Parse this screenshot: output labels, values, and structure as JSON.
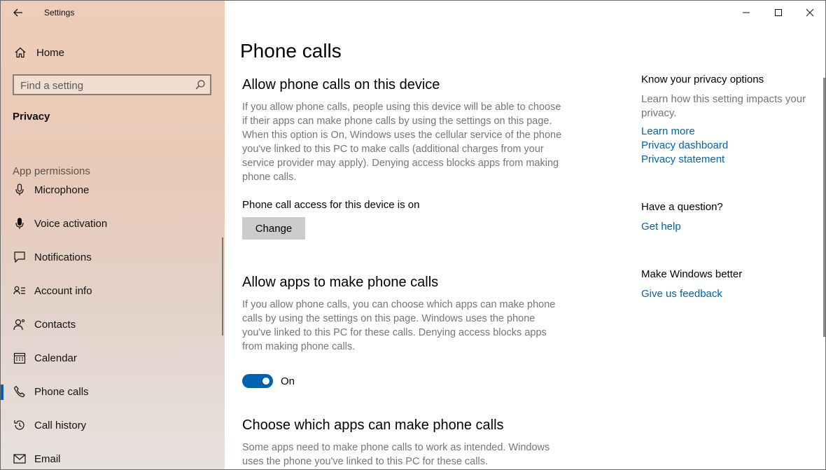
{
  "window": {
    "title": "Settings"
  },
  "sidebar": {
    "home_label": "Home",
    "search_placeholder": "Find a setting",
    "section_title": "Privacy",
    "perm_header": "App permissions",
    "items": [
      {
        "label": "Microphone",
        "icon": "microphone-icon"
      },
      {
        "label": "Voice activation",
        "icon": "voice-activation-icon"
      },
      {
        "label": "Notifications",
        "icon": "notifications-icon"
      },
      {
        "label": "Account info",
        "icon": "account-info-icon"
      },
      {
        "label": "Contacts",
        "icon": "contacts-icon"
      },
      {
        "label": "Calendar",
        "icon": "calendar-icon"
      },
      {
        "label": "Phone calls",
        "icon": "phone-icon",
        "active": true
      },
      {
        "label": "Call history",
        "icon": "call-history-icon"
      },
      {
        "label": "Email",
        "icon": "email-icon"
      }
    ]
  },
  "main": {
    "title": "Phone calls",
    "section1": {
      "heading": "Allow phone calls on this device",
      "desc": "If you allow phone calls, people using this device will be able to choose if their apps can make phone calls by using the settings on this page. When this option is On, Windows uses the cellular service of the phone you've linked to this PC to make calls (additional charges from your service provider may apply). Denying access blocks apps from making phone calls.",
      "status": "Phone call access for this device is on",
      "button": "Change"
    },
    "section2": {
      "heading": "Allow apps to make phone calls",
      "desc": "If you allow phone calls, you can choose which apps can make phone calls by using the settings on this page. Windows uses the phone you've linked to this PC for these calls. Denying access blocks apps from making phone calls.",
      "toggle_state": "On",
      "toggle_on": true
    },
    "section3": {
      "heading": "Choose which apps can make phone calls",
      "desc": "Some apps need to make phone calls to work as intended. Windows uses the phone you've linked to this PC for these calls."
    }
  },
  "right_panel": {
    "privacy": {
      "heading": "Know your privacy options",
      "text": "Learn how this setting impacts your privacy.",
      "links": [
        "Learn more",
        "Privacy dashboard",
        "Privacy statement"
      ]
    },
    "question": {
      "heading": "Have a question?",
      "link": "Get help"
    },
    "better": {
      "heading": "Make Windows better",
      "link": "Give us feedback"
    }
  },
  "colors": {
    "accent": "#0063b1",
    "secondary_text": "#767676"
  }
}
